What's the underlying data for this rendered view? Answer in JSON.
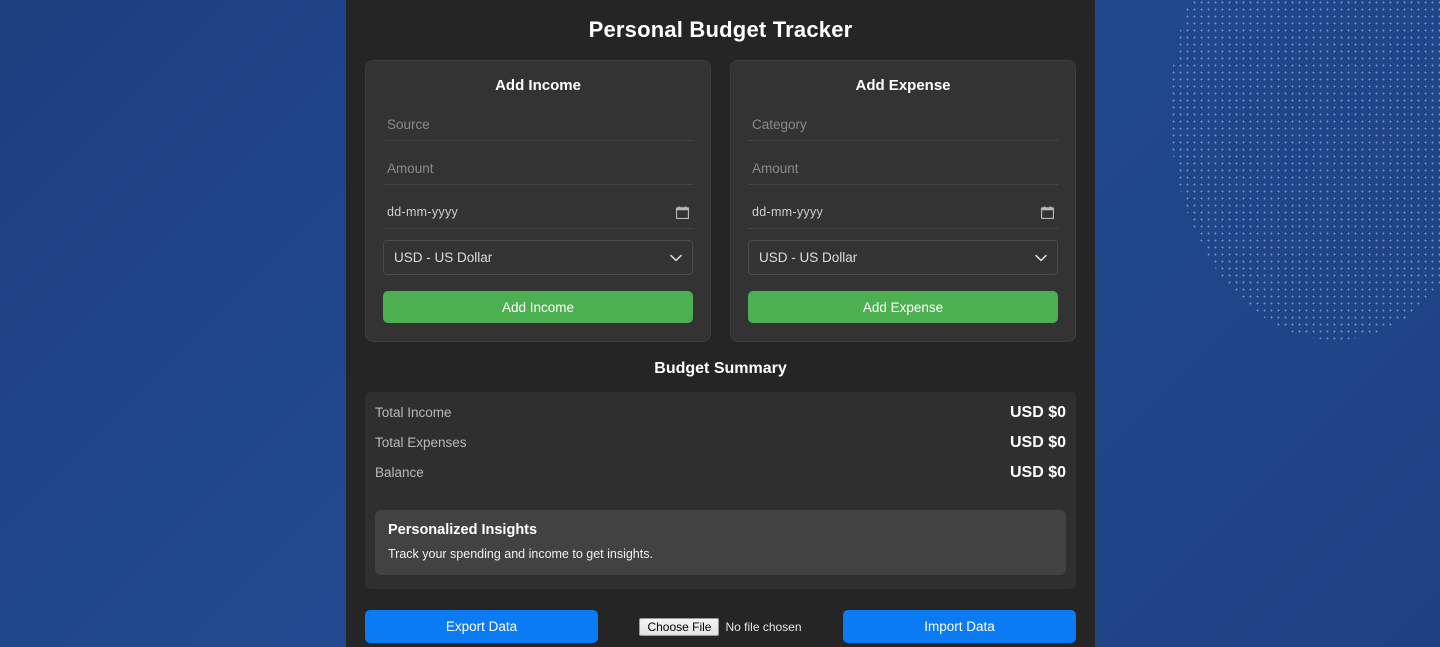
{
  "app": {
    "title": "Personal Budget Tracker",
    "background_color": "#1f4287",
    "panel_color": "#252525",
    "accent_green": "#4caf50",
    "accent_blue": "#0b7bf4"
  },
  "income_card": {
    "title": "Add Income",
    "source_placeholder": "Source",
    "source_value": "",
    "amount_placeholder": "Amount",
    "amount_value": "",
    "date_placeholder": "dd-mm-yyyy",
    "date_value": "",
    "currency_selected": "USD - US Dollar",
    "submit_label": "Add Income"
  },
  "expense_card": {
    "title": "Add Expense",
    "category_placeholder": "Category",
    "category_value": "",
    "amount_placeholder": "Amount",
    "amount_value": "",
    "date_placeholder": "dd-mm-yyyy",
    "date_value": "",
    "currency_selected": "USD - US Dollar",
    "submit_label": "Add Expense"
  },
  "summary": {
    "title": "Budget Summary",
    "rows": [
      {
        "label": "Total Income",
        "value": "USD $0"
      },
      {
        "label": "Total Expenses",
        "value": "USD $0"
      },
      {
        "label": "Balance",
        "value": "USD $0"
      }
    ]
  },
  "insights": {
    "title": "Personalized Insights",
    "text": "Track your spending and income to get insights."
  },
  "actions": {
    "export_label": "Export Data",
    "import_label": "Import Data",
    "choose_file_label": "Choose File",
    "file_status": "No file chosen"
  }
}
